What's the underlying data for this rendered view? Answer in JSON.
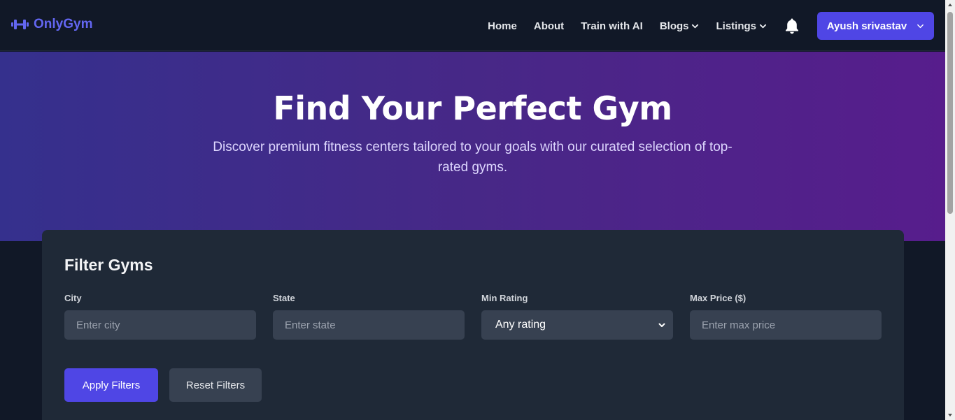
{
  "brand": {
    "name": "OnlyGym",
    "icon": "dumbbell-icon",
    "color": "#6366f1"
  },
  "nav": {
    "links": [
      {
        "label": "Home",
        "has_dropdown": false
      },
      {
        "label": "About",
        "has_dropdown": false
      },
      {
        "label": "Train with AI",
        "has_dropdown": false
      },
      {
        "label": "Blogs",
        "has_dropdown": true
      },
      {
        "label": "Listings",
        "has_dropdown": true
      }
    ],
    "notification_icon": "bell-icon",
    "user": {
      "label": "Ayush srivastav",
      "icon": "chevron-down-icon",
      "color": "#4f46e5"
    }
  },
  "hero": {
    "title": "Find Your Perfect Gym",
    "subtitle": "Discover premium fitness centers tailored to your goals with our curated selection of top-rated gyms."
  },
  "filters": {
    "title": "Filter Gyms",
    "city": {
      "label": "City",
      "placeholder": "Enter city"
    },
    "state": {
      "label": "State",
      "placeholder": "Enter state"
    },
    "min_rating": {
      "label": "Min Rating",
      "selected": "Any rating"
    },
    "max_price": {
      "label": "Max Price ($)",
      "placeholder": "Enter max price"
    },
    "apply_label": "Apply Filters",
    "reset_label": "Reset Filters"
  },
  "colors": {
    "page_bg": "#111827",
    "card_bg": "#1f2937",
    "input_bg": "#374151",
    "accent": "#4f46e5",
    "hero_gradient": [
      "#35308d",
      "#571d8c"
    ]
  }
}
